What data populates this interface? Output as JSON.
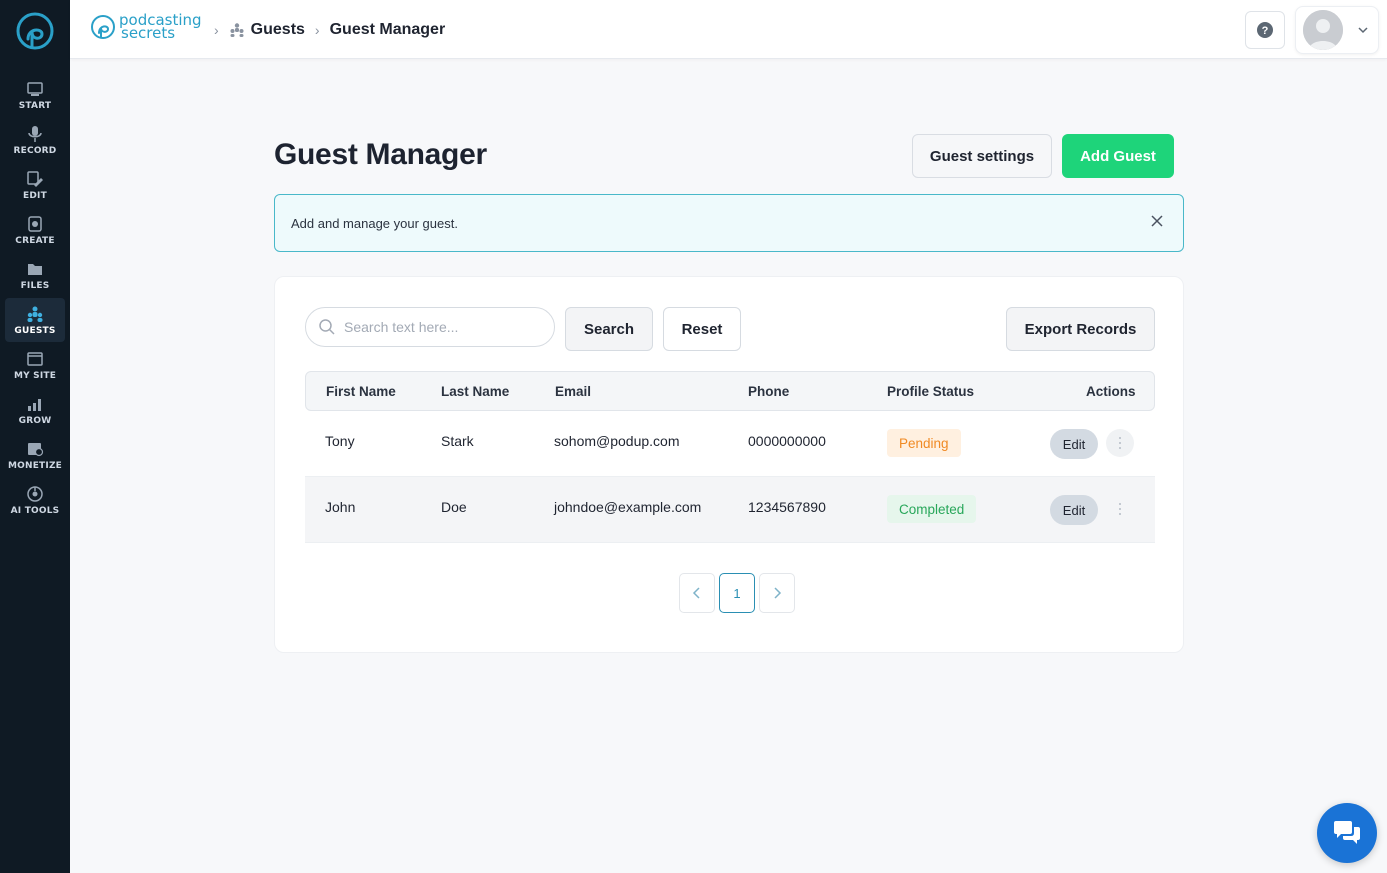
{
  "sidebar": {
    "items": [
      {
        "label": "START",
        "icon": "start-icon"
      },
      {
        "label": "RECORD",
        "icon": "microphone-icon"
      },
      {
        "label": "EDIT",
        "icon": "edit-icon"
      },
      {
        "label": "CREATE",
        "icon": "create-icon"
      },
      {
        "label": "FILES",
        "icon": "files-icon"
      },
      {
        "label": "GUESTS",
        "icon": "guests-icon",
        "active": true
      },
      {
        "label": "MY SITE",
        "icon": "site-icon"
      },
      {
        "label": "GROW",
        "icon": "grow-icon"
      },
      {
        "label": "MONETIZE",
        "icon": "monetize-icon"
      },
      {
        "label": "AI TOOLS",
        "icon": "ai-tools-icon"
      }
    ]
  },
  "header": {
    "brand_line1": "podcasting",
    "brand_line2": "secrets",
    "breadcrumb": [
      "Guests",
      "Guest Manager"
    ]
  },
  "main": {
    "title": "Guest Manager",
    "settings_label": "Guest settings",
    "add_label": "Add Guest",
    "notice": "Add and manage your guest.",
    "search_placeholder": "Search text here...",
    "search_label": "Search",
    "reset_label": "Reset",
    "export_label": "Export Records",
    "columns": [
      "First Name",
      "Last Name",
      "Email",
      "Phone",
      "Profile Status",
      "Actions"
    ],
    "rows": [
      {
        "first": "Tony",
        "last": "Stark",
        "email": "sohom@podup.com",
        "phone": "0000000000",
        "status": "Pending",
        "action": "Edit"
      },
      {
        "first": "John",
        "last": "Doe",
        "email": "johndoe@example.com",
        "phone": "1234567890",
        "status": "Completed",
        "action": "Edit"
      }
    ],
    "page": "1"
  },
  "colors": {
    "sidebar": "#0f1a24",
    "accent_green": "#1ed47a",
    "notice_border": "#49b8c9",
    "pending": "#f08a24",
    "completed": "#28a75a",
    "chat": "#1a73d6"
  }
}
